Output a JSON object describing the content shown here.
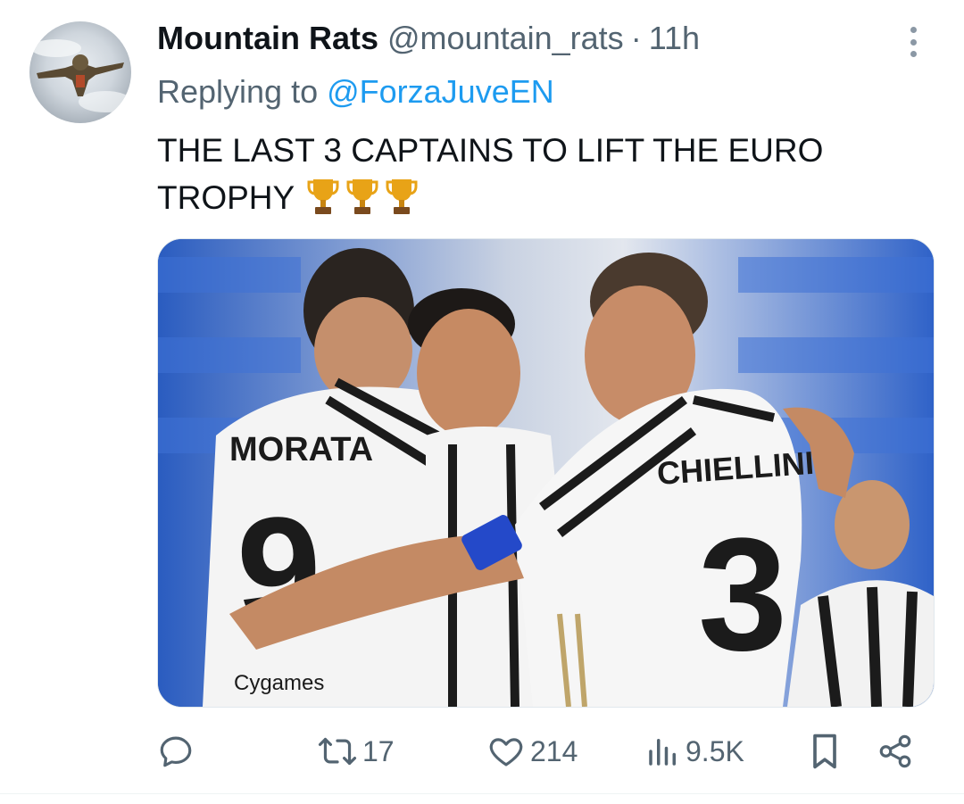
{
  "tweet": {
    "author_name": "Mountain Rats",
    "handle": "@mountain_rats",
    "separator": "·",
    "time": "11h",
    "replying_prefix": "Replying to ",
    "replying_to": "@ForzaJuveEN",
    "text": "THE LAST 3 CAPTAINS TO LIFT THE EURO TROPHY",
    "emoji": [
      "trophy-icon",
      "trophy-icon",
      "trophy-icon"
    ]
  },
  "media": {
    "jersey_left_name": "MORATA",
    "jersey_left_number": "9",
    "jersey_right_name": "CHIELLINI",
    "jersey_right_number": "3",
    "sponsor": "Cygames"
  },
  "actions": {
    "replies": "",
    "retweets": "17",
    "likes": "214",
    "views": "9.5K"
  },
  "colors": {
    "text": "#0f1419",
    "secondary": "#536471",
    "link": "#1d9bf0",
    "icon": "#536471"
  }
}
